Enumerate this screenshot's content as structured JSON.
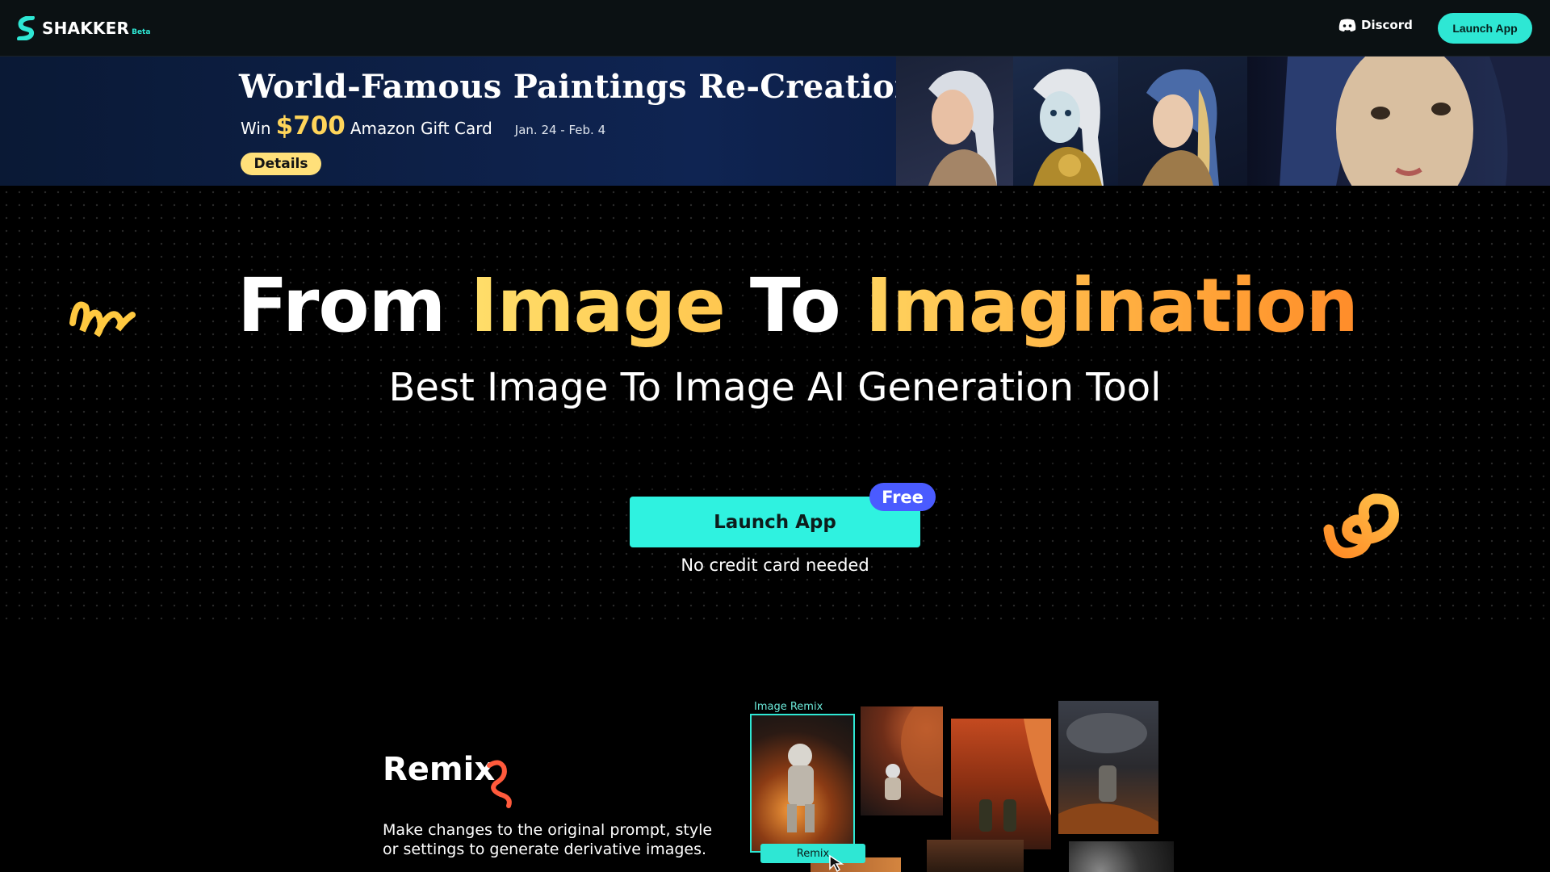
{
  "nav": {
    "logo_text": "SHAKKER",
    "logo_badge": "Beta",
    "discord_label": "Discord",
    "launch_label": "Launch App"
  },
  "banner": {
    "title": "World-Famous Paintings Re-Creation Challenge",
    "win": "Win",
    "amount": "$700",
    "gift": "Amazon Gift Card",
    "dates": "Jan. 24  -  Feb. 4",
    "details_label": "Details"
  },
  "hero": {
    "title_from": "From",
    "title_image": "Image",
    "title_to": "To",
    "title_imagination": "Imagination",
    "subtitle": "Best Image To Image AI Generation Tool",
    "launch_label": "Launch App",
    "free_badge": "Free",
    "note": "No credit card needed"
  },
  "remix": {
    "title": "Remix",
    "description": "Make changes to the original prompt, style or settings to generate derivative images.",
    "image_label": "Image Remix",
    "remix_button": "Remix"
  },
  "colors": {
    "accent": "#2ee7d4",
    "yellow": "#ffd55a",
    "orange": "#ff9c32",
    "badge_blue": "#4a5bff"
  }
}
